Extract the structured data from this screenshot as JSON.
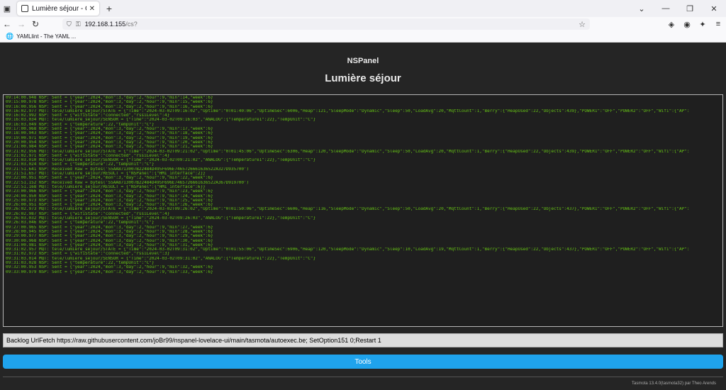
{
  "browser": {
    "tab_title": "Lumière séjour - Console",
    "url_host": "192.168.1.155",
    "url_path": "/cs?",
    "bookmark": "YAMLlint - The YAML ..."
  },
  "page": {
    "device": "NSPanel",
    "title": "Lumière séjour",
    "command_value": "Backlog UrlFetch https://raw.githubusercontent.com/joBr99/nspanel-lovelace-ui/main/tasmota/autoexec.be; SetOption151 0;Restart 1",
    "tools_label": "Tools",
    "footer": "Tasmota 13.4.0(tasmota32) par Theo Arends"
  },
  "console_lines": [
    "09:14:00.948 NSP: Sent = {\"year\":2024,\"mon\":3,\"day\":2,\"hour\":9,\"min\":14,\"week\":6}",
    "09:15:00.978 NSP: Sent = {\"year\":2024,\"mon\":3,\"day\":2,\"hour\":9,\"min\":15,\"week\":6}",
    "09:16:00.956 NSP: Sent = {\"year\":2024,\"mon\":3,\"day\":2,\"hour\":9,\"min\":16,\"week\":6}",
    "09:16:02.977 MQT: tele/lumiere_sejour/STATE = {\"Time\":\"2024-03-02T09:16:02\",\"Uptime\":\"0T01:40:06\",\"UptimeSec\":6006,\"Heap\":121,\"SleepMode\":\"Dynamic\",\"Sleep\":50,\"LoadAvg\":20,\"MqttCount\":1,\"Berry\":{\"HeapUsed\":22,\"Objects\":439},\"POWER1\":\"OFF\",\"POWER2\":\"OFF\",\"Wifi\":{\"AP\":",
    "09:16:02.992 NSP: Sent = {\"wifiState\":\"connected\",\"rssiLevel\":4}",
    "09:16:03.034 MQT: tele/lumiere_sejour/SENSOR = {\"Time\":\"2024-03-02T09:16:03\",\"ANALOG\":{\"Temperature1\":22},\"TempUnit\":\"C\"}",
    "09:16:03.049 NSP: Sent = {\"temperature\":22,\"tempUnit\":\"C\"}",
    "09:17:00.968 NSP: Sent = {\"year\":2024,\"mon\":3,\"day\":2,\"hour\":9,\"min\":17,\"week\":6}",
    "09:18:00.943 NSP: Sent = {\"year\":2024,\"mon\":3,\"day\":2,\"hour\":9,\"min\":18,\"week\":6}",
    "09:19:00.971 NSP: Sent = {\"year\":2024,\"mon\":3,\"day\":2,\"hour\":9,\"min\":19,\"week\":6}",
    "09:20:00.954 NSP: Sent = {\"year\":2024,\"mon\":3,\"day\":2,\"hour\":9,\"min\":20,\"week\":6}",
    "09:21:00.984 NSP: Sent = {\"year\":2024,\"mon\":3,\"day\":2,\"hour\":9,\"min\":21,\"week\":6}",
    "09:21:02.956 MQT: tele/lumiere_sejour/STATE = {\"Time\":\"2024-03-02T09:21:02\",\"Uptime\":\"0T01:45:06\",\"UptimeSec\":6306,\"Heap\":120,\"SleepMode\":\"Dynamic\",\"Sleep\":50,\"LoadAvg\":20,\"MqttCount\":1,\"Berry\":{\"HeapUsed\":22,\"Objects\":439},\"POWER1\":\"OFF\",\"POWER2\":\"OFF\",\"Wifi\":{\"AP\":",
    "09:21:02.971 NSP: Sent = {\"wifiState\":\"connected\",\"rssiLevel\":4}",
    "09:21:03.010 MQT: tele/lumiere_sejour/SENSOR = {\"Time\":\"2024-03-02T09:21:02\",\"ANALOG\":{\"Temperature1\":22},\"TempUnit\":\"C\"}",
    "09:21:03.024 NSP: Sent = {\"temperature\":22,\"tempUnit\":\"C\"}",
    "09:21:51.641 NSP: Received Raw = bytes('55AA8713007B22484D495F696E7465726661636522A327D935700')",
    "09:21:51.657 MQT: tele/lumiere_sejour/RESULT = {\"NSPanel\":{\"HMI_interface\":2}}",
    "09:22:00.951 NSP: Sent = {\"year\":2024,\"mon\":3,\"day\":2,\"hour\":9,\"min\":22,\"week\":6}",
    "09:22:51.152 NSP: Received Raw = bytes('55AA8713007B22484D495F696E7465726661636522A367D919700')",
    "09:22:51.168 MQT: tele/lumiere_sejour/RESULT = {\"NSPanel\":{\"HMI_interface\":6}}",
    "09:23:00.966 NSP: Sent = {\"year\":2024,\"mon\":3,\"day\":2,\"hour\":9,\"min\":23,\"week\":6}",
    "09:24:00.950 NSP: Sent = {\"year\":2024,\"mon\":3,\"day\":2,\"hour\":9,\"min\":24,\"week\":6}",
    "09:25:00.973 NSP: Sent = {\"year\":2024,\"mon\":3,\"day\":2,\"hour\":9,\"min\":25,\"week\":6}",
    "09:26:00.951 NSP: Sent = {\"year\":2024,\"mon\":3,\"day\":2,\"hour\":9,\"min\":26,\"week\":6}",
    "09:26:02.973 MQT: tele/lumiere_sejour/STATE = {\"Time\":\"2024-03-02T09:26:02\",\"Uptime\":\"0T01:50:06\",\"UptimeSec\":6606,\"Heap\":116,\"SleepMode\":\"Dynamic\",\"Sleep\":50,\"LoadAvg\":20,\"MqttCount\":1,\"Berry\":{\"HeapUsed\":22,\"Objects\":437},\"POWER1\":\"OFF\",\"POWER2\":\"OFF\",\"Wifi\":{\"AP\":",
    "09:26:02.987 NSP: Sent = {\"wifiState\":\"connected\",\"rssiLevel\":4}",
    "09:26:03.032 MQT: tele/lumiere_sejour/SENSOR = {\"Time\":\"2024-03-02T09:26:03\",\"ANALOG\":{\"Temperature1\":22},\"TempUnit\":\"C\"}",
    "09:26:03.046 NSP: Sent = {\"temperature\":22,\"tempUnit\":\"C\"}",
    "09:27:00.965 NSP: Sent = {\"year\":2024,\"mon\":3,\"day\":2,\"hour\":9,\"min\":27,\"week\":6}",
    "09:28:00.945 NSP: Sent = {\"year\":2024,\"mon\":3,\"day\":2,\"hour\":9,\"min\":28,\"week\":6}",
    "09:29:00.977 NSP: Sent = {\"year\":2024,\"mon\":3,\"day\":2,\"hour\":9,\"min\":29,\"week\":6}",
    "09:30:00.968 NSP: Sent = {\"year\":2024,\"mon\":3,\"day\":2,\"hour\":9,\"min\":30,\"week\":6}",
    "09:31:00.981 NSP: Sent = {\"year\":2024,\"mon\":3,\"day\":2,\"hour\":9,\"min\":31,\"week\":6}",
    "09:31:02.957 MQT: tele/lumiere_sejour/STATE = {\"Time\":\"2024-03-02T09:31:02\",\"Uptime\":\"0T01:55:06\",\"UptimeSec\":6906,\"Heap\":120,\"SleepMode\":\"Dynamic\",\"Sleep\":10,\"LoadAvg\":19,\"MqttCount\":1,\"Berry\":{\"HeapUsed\":22,\"Objects\":437},\"POWER1\":\"OFF\",\"POWER2\":\"OFF\",\"Wifi\":{\"AP\":",
    "09:31:02.972 NSP: Sent = {\"wifiState\":\"connected\",\"rssiLevel\":3}",
    "09:31:03.014 MQT: tele/lumiere_sejour/SENSOR = {\"Time\":\"2024-03-02T09:31:02\",\"ANALOG\":{\"Temperature1\":22},\"TempUnit\":\"C\"}",
    "09:31:03.028 NSP: Sent = {\"temperature\":22,\"tempUnit\":\"C\"}",
    "09:32:00.953 NSP: Sent = {\"year\":2024,\"mon\":3,\"day\":2,\"hour\":9,\"min\":32,\"week\":6}",
    "09:33:00.979 NSP: Sent = {\"year\":2024,\"mon\":3,\"day\":2,\"hour\":9,\"min\":33,\"week\":6}"
  ],
  "colors": {
    "background": "#252525",
    "console_text": "#65c115",
    "button": "#1fa3ec"
  }
}
